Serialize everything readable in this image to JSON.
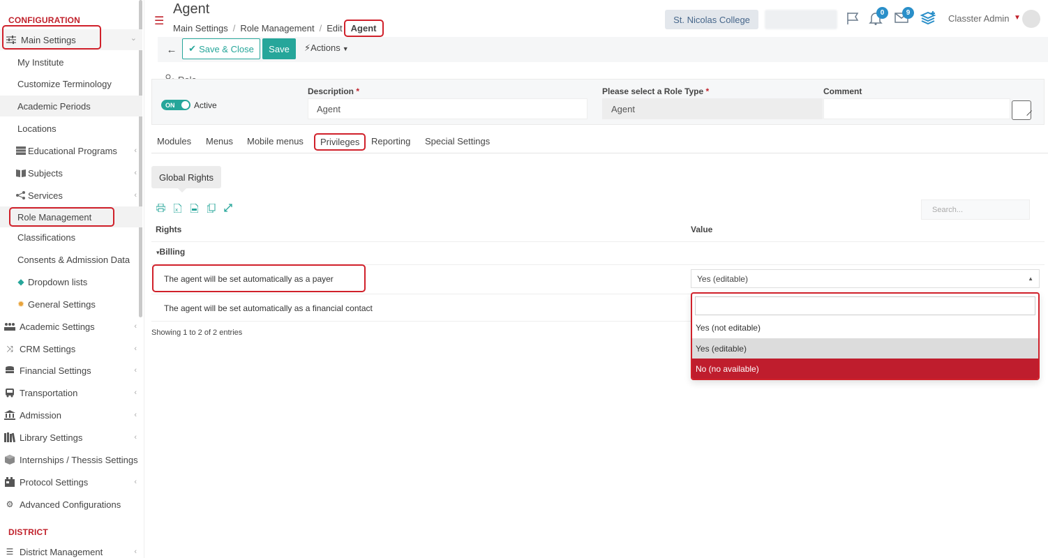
{
  "sidebar": {
    "section_configuration": "CONFIGURATION",
    "main_settings": "Main Settings",
    "sub_items": [
      "My Institute",
      "Customize Terminology",
      "Academic Periods",
      "Locations",
      "Educational Programs",
      "Subjects",
      "Services",
      "Role Management",
      "Classifications",
      "Consents & Admission Data",
      "Dropdown lists",
      "General Settings"
    ],
    "top_items": [
      "Academic Settings",
      "CRM Settings",
      "Financial Settings",
      "Transportation",
      "Admission",
      "Library Settings",
      "Internships / Thessis Settings",
      "Protocol Settings",
      "Advanced Configurations"
    ],
    "section_district": "DISTRICT",
    "district_items": [
      "District Management"
    ]
  },
  "header": {
    "title": "Agent",
    "breadcrumb": [
      "Main Settings",
      "Role Management",
      "Edit",
      "Agent"
    ],
    "college": "St. Nicolas College",
    "notifications_count": "0",
    "messages_count": "9",
    "user_name": "Classter Admin"
  },
  "toolbar": {
    "save_close": "Save & Close",
    "save": "Save",
    "actions": "Actions"
  },
  "role": {
    "section_label": "Role",
    "toggle_state": "ON",
    "toggle_label": "Active",
    "description_label": "Description",
    "description_value": "Agent",
    "role_type_label": "Please select a Role Type",
    "role_type_value": "Agent",
    "comment_label": "Comment",
    "comment_value": ""
  },
  "tabs": [
    "Modules",
    "Menus",
    "Mobile menus",
    "Privileges",
    "Reporting",
    "Special Settings"
  ],
  "active_tab": "Privileges",
  "global_rights": "Global Rights",
  "table": {
    "search_placeholder": "Search...",
    "columns": [
      "Rights",
      "Value"
    ],
    "group": "Billing",
    "rows": [
      {
        "right": "The agent will be set automatically as a payer",
        "value": "Yes (editable)"
      },
      {
        "right": "The agent will be set automatically as a financial contact",
        "value": ""
      }
    ],
    "footer": "Showing 1 to 2 of 2 entries"
  },
  "dropdown": {
    "search_value": "",
    "options": [
      "Yes (not editable)",
      "Yes (editable)",
      "No (no available)"
    ],
    "selected": "Yes (editable)",
    "highlighted": "No (no available)"
  },
  "colors": {
    "brand_red": "#c0202a",
    "accent_teal": "#26a69a",
    "badge_blue": "#2a8fc9",
    "highlight_red": "#bf1d2d"
  }
}
